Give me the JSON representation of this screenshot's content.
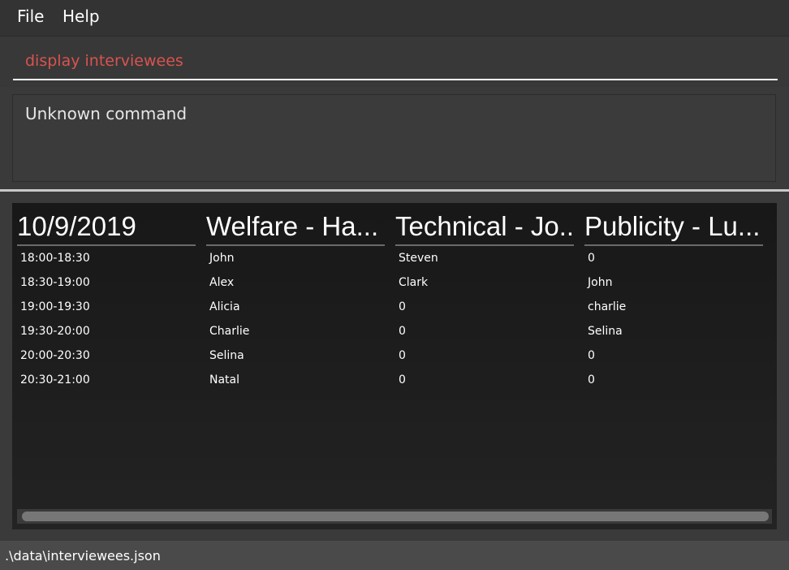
{
  "menu": {
    "file": "File",
    "help": "Help"
  },
  "command": {
    "value": "display interviewees"
  },
  "result": {
    "message": "Unknown command"
  },
  "table": {
    "columns": [
      {
        "header": "10/9/2019",
        "cells": [
          "18:00-18:30",
          "18:30-19:00",
          "19:00-19:30",
          "19:30-20:00",
          "20:00-20:30",
          "20:30-21:00"
        ]
      },
      {
        "header": "Welfare - Ha...",
        "cells": [
          "John",
          "Alex",
          "Alicia",
          "Charlie",
          "Selina",
          "Natal"
        ]
      },
      {
        "header": "Technical - Jo...",
        "cells": [
          "Steven",
          "Clark",
          "0",
          "0",
          "0",
          "0"
        ]
      },
      {
        "header": "Publicity - Lu...",
        "cells": [
          "0",
          "John",
          "charlie",
          "Selina",
          "0",
          "0"
        ]
      }
    ]
  },
  "status": {
    "path": ".\\data\\interviewees.json"
  },
  "colors": {
    "command_text": "#d9534f",
    "background": "#3a3a3a",
    "table_background": "#1c1c1c"
  }
}
